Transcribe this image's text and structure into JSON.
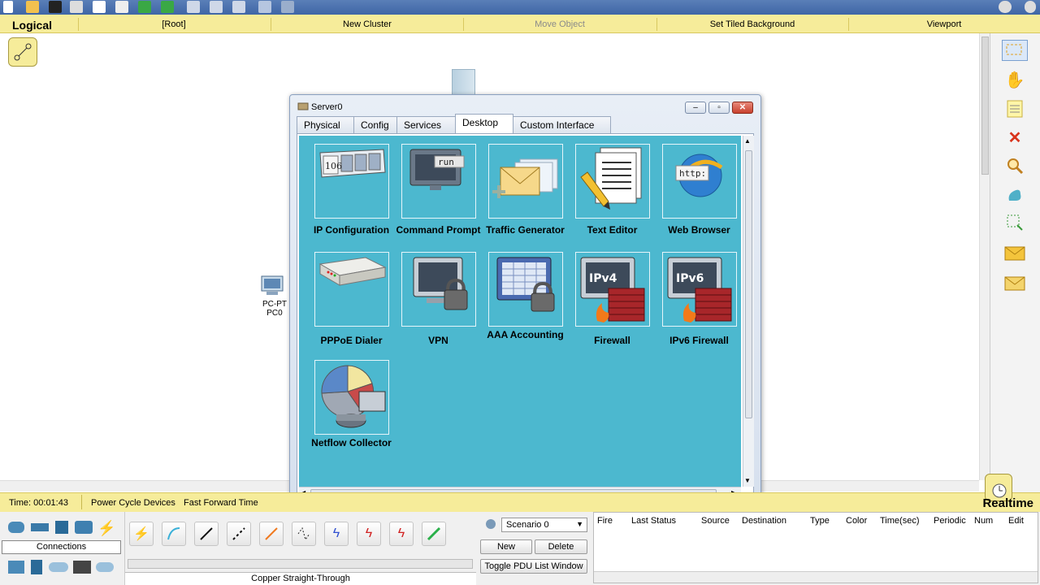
{
  "logical_bar": {
    "view_label": "Logical",
    "root_label": "[Root]",
    "new_cluster_label": "New Cluster",
    "move_object_label": "Move Object",
    "set_tiled_background_label": "Set Tiled Background",
    "viewport_label": "Viewport"
  },
  "workspace": {
    "pc": {
      "type_label": "PC-PT",
      "name_label": "PC0"
    }
  },
  "dialog": {
    "title": "Server0",
    "tabs": [
      {
        "label": "Physical"
      },
      {
        "label": "Config"
      },
      {
        "label": "Services"
      },
      {
        "label": "Desktop"
      },
      {
        "label": "Custom Interface"
      }
    ],
    "active_tab": "Desktop",
    "apps": [
      {
        "label": "IP Configuration",
        "icon": "ip-configuration-icon",
        "screen_text": "106"
      },
      {
        "label": "Command Prompt",
        "icon": "command-prompt-icon",
        "screen_text": "run"
      },
      {
        "label": "Traffic Generator",
        "icon": "traffic-generator-icon"
      },
      {
        "label": "Text Editor",
        "icon": "text-editor-icon"
      },
      {
        "label": "Web Browser",
        "icon": "web-browser-icon",
        "screen_text": "http:"
      },
      {
        "label": "PPPoE Dialer",
        "icon": "pppoe-dialer-icon"
      },
      {
        "label": "VPN",
        "icon": "vpn-icon"
      },
      {
        "label": "AAA Accounting",
        "icon": "aaa-accounting-icon"
      },
      {
        "label": "Firewall",
        "icon": "firewall-icon",
        "screen_text": "IPv4"
      },
      {
        "label": "IPv6 Firewall",
        "icon": "ipv6-firewall-icon",
        "screen_text": "IPv6"
      },
      {
        "label": "Netflow Collector",
        "icon": "netflow-collector-icon"
      }
    ]
  },
  "time_bar": {
    "time_label": "Time: 00:01:43",
    "power_cycle_label": "Power Cycle Devices",
    "fast_forward_label": "Fast Forward Time",
    "mode_label": "Realtime"
  },
  "bottom": {
    "category_label": "Connections",
    "selected_cable_label": "Copper Straight-Through",
    "scenario_value": "Scenario 0",
    "new_label": "New",
    "delete_label": "Delete",
    "toggle_pdu_label": "Toggle PDU List Window",
    "pdu_headers": [
      "Fire",
      "Last Status",
      "Source",
      "Destination",
      "Type",
      "Color",
      "Time(sec)",
      "Periodic",
      "Num",
      "Edit"
    ]
  },
  "colors": {
    "desktop_bg": "#4cb8cf",
    "logical_bar": "#f6ec9a",
    "toolbar": "#4a72b0"
  }
}
